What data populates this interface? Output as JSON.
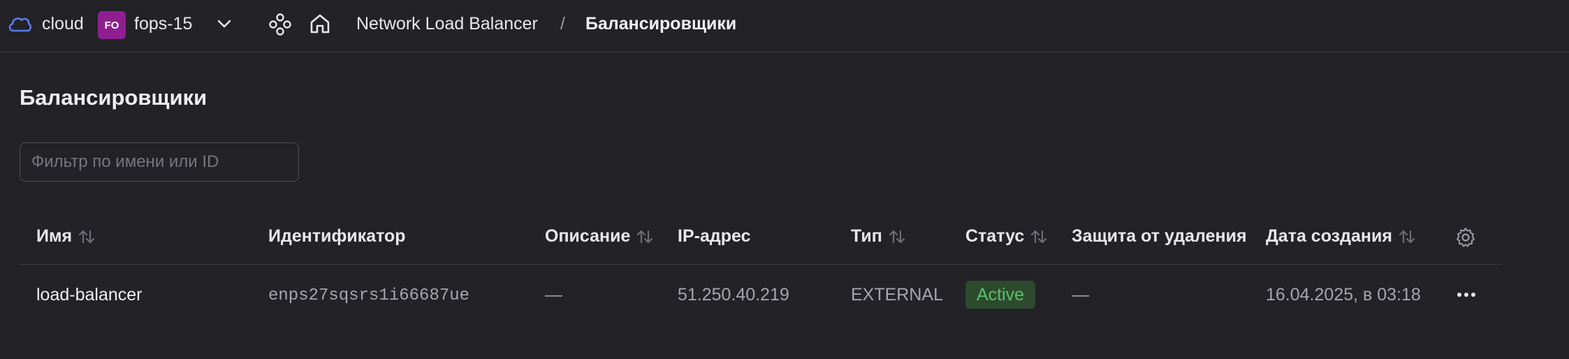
{
  "topbar": {
    "cloud_label": "cloud",
    "folder_badge": "FO",
    "folder_name": "fops-15",
    "breadcrumb": {
      "service": "Network Load Balancer",
      "separator": "/",
      "current": "Балансировщики"
    },
    "icons": [
      "cloud-icon",
      "chevron-down-icon",
      "services-icon",
      "home-icon"
    ]
  },
  "main": {
    "title": "Балансировщики",
    "filter_placeholder": "Фильтр по имени или ID",
    "filter_value": ""
  },
  "table": {
    "columns": [
      {
        "label": "Имя",
        "sortable": true
      },
      {
        "label": "Идентификатор",
        "sortable": false
      },
      {
        "label": "Описание",
        "sortable": true
      },
      {
        "label": "IP-адрес",
        "sortable": false
      },
      {
        "label": "Тип",
        "sortable": true
      },
      {
        "label": "Статус",
        "sortable": true
      },
      {
        "label": "Защита от удаления",
        "sortable": false
      },
      {
        "label": "Дата создания",
        "sortable": true
      }
    ],
    "rows": [
      {
        "name": "load-balancer",
        "id": "enps27sqsrs1i66687ue",
        "description": "—",
        "ip": "51.250.40.219",
        "type": "EXTERNAL",
        "status": "Active",
        "deletion_protection": "—",
        "created": "16.04.2025, в 03:18"
      }
    ]
  },
  "colors": {
    "background": "#232227",
    "folder_badge": "#8f1f91",
    "status_active_text": "#58c265",
    "status_active_bg": "#2d4a2f",
    "cloud_icon": "#5b7cf0"
  }
}
